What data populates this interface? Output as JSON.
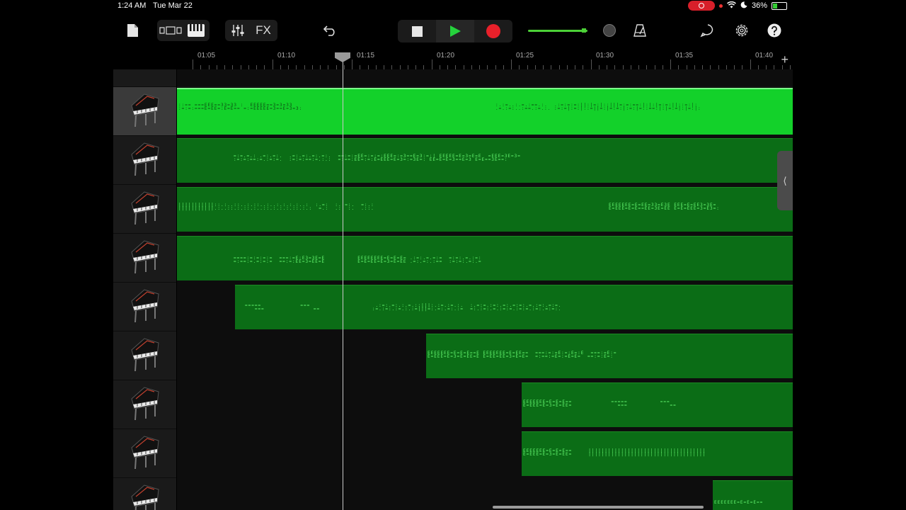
{
  "status_bar": {
    "time": "1:24 AM",
    "date": "Tue Mar 22",
    "battery": "36%"
  },
  "toolbar": {
    "fx_label": "FX"
  },
  "ruler": {
    "labels": [
      "01:05",
      "01:10",
      "01:15",
      "01:20",
      "01:25",
      "01:30",
      "01:35",
      "01:40"
    ]
  },
  "tracks": [
    {
      "instrument": "grand-piano",
      "selected": true
    },
    {
      "instrument": "grand-piano",
      "selected": false
    },
    {
      "instrument": "grand-piano",
      "selected": false
    },
    {
      "instrument": "grand-piano",
      "selected": false
    },
    {
      "instrument": "grand-piano",
      "selected": false
    },
    {
      "instrument": "grand-piano",
      "selected": false
    },
    {
      "instrument": "grand-piano",
      "selected": false
    },
    {
      "instrument": "grand-piano",
      "selected": false
    },
    {
      "instrument": "grand-piano",
      "selected": false
    }
  ],
  "colors": {
    "region": "#0b6d16",
    "region_selected": "#13d12a",
    "record": "#e8202a",
    "play": "#25d23c"
  }
}
